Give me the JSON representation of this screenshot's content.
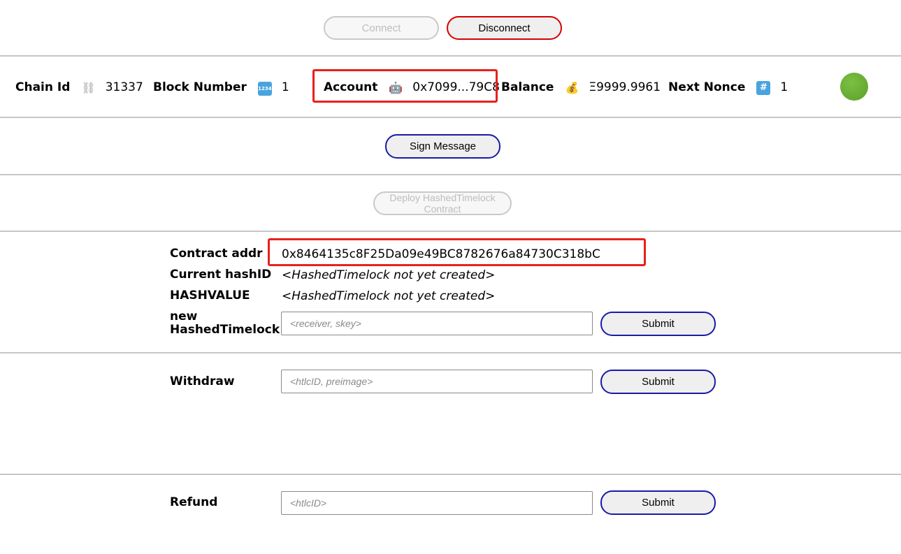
{
  "toolbar": {
    "connect_label": "Connect",
    "disconnect_label": "Disconnect"
  },
  "status": {
    "chain_id_label": "Chain Id",
    "chain_id_icon": "⛓",
    "chain_id_value": "31337",
    "block_number_label": "Block Number",
    "block_number_icon": "1234",
    "block_number_value": "1",
    "account_label": "Account",
    "account_icon": "🤖",
    "account_value": "0x7099...79C8",
    "balance_label": "Balance",
    "balance_icon": "💰",
    "balance_value": "Ξ9999.9961",
    "next_nonce_label": "Next Nonce",
    "next_nonce_icon": "#️⃣",
    "next_nonce_value": "1",
    "connected_color": "#6aae35"
  },
  "sign": {
    "label": "Sign Message"
  },
  "deploy": {
    "label": "Deploy HashedTimelock Contract"
  },
  "contract": {
    "addr_label": "Contract addr",
    "addr_value": "0x8464135c8F25Da09e49BC8782676a84730C318bC",
    "hashid_label": "Current hashID",
    "hashid_value": "<HashedTimelock not yet created>",
    "hashvalue_label": "HASHVALUE",
    "hashvalue_value": "<HashedTimelock not yet created>",
    "new_label": "new HashedTimelock",
    "new_placeholder": "<receiver, skey>",
    "new_submit": "Submit"
  },
  "withdraw": {
    "label": "Withdraw",
    "placeholder": "<htlcID, preimage>",
    "submit": "Submit"
  },
  "refund": {
    "label": "Refund",
    "placeholder": "<htlcID>",
    "submit": "Submit"
  },
  "colors": {
    "annotation": "#e8201c",
    "button_border_blue": "#1a1aa8",
    "button_border_red": "#d60000"
  }
}
